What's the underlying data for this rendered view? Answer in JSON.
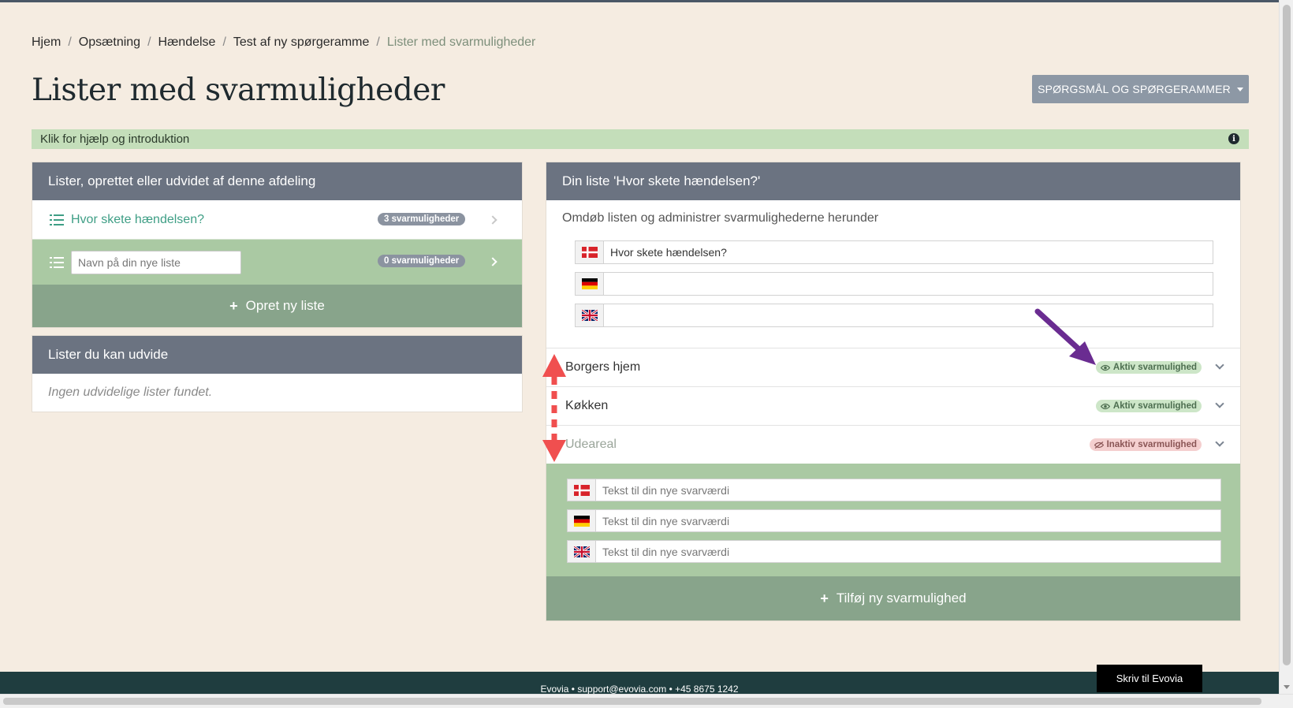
{
  "breadcrumb": {
    "items": [
      "Hjem",
      "Opsætning",
      "Hændelse",
      "Test af ny spørgeramme"
    ],
    "active": "Lister med svarmuligheder",
    "separator": "/"
  },
  "page": {
    "title": "Lister med svarmuligheder",
    "dropdown_label": "SPØRGSMÅL OG SPØRGERAMMER"
  },
  "help": {
    "text": "Klik for hjælp og introduktion",
    "icon": "info-icon"
  },
  "lists_panel": {
    "header": "Lister, oprettet eller udvidet af denne afdeling",
    "items": [
      {
        "label": "Hvor skete hændelsen?",
        "badge": "3 svarmuligheder"
      }
    ],
    "new_list": {
      "placeholder": "Navn på din nye liste",
      "badge": "0 svarmuligheder"
    },
    "create_label": "Opret ny liste"
  },
  "extend_panel": {
    "header": "Lister du kan udvide",
    "empty_text": "Ingen udvidelige lister fundet."
  },
  "detail_panel": {
    "header": "Din liste 'Hvor skete hændelsen?'",
    "subtitle": "Omdøb listen og administrer svarmulighederne herunder",
    "name_inputs": [
      {
        "flag": "dk-flag",
        "value": "Hvor skete hændelsen?"
      },
      {
        "flag": "de-flag",
        "value": ""
      },
      {
        "flag": "gb-flag",
        "value": ""
      }
    ],
    "options": [
      {
        "label": "Borgers hjem",
        "status": "Aktiv svarmulighed",
        "state": "active"
      },
      {
        "label": "Køkken",
        "status": "Aktiv svarmulighed",
        "state": "active"
      },
      {
        "label": "Udeareal",
        "status": "Inaktiv svarmulighed",
        "state": "inactive"
      }
    ],
    "new_value_inputs": [
      {
        "flag": "dk-flag",
        "placeholder": "Tekst til din nye svarværdi"
      },
      {
        "flag": "de-flag",
        "placeholder": "Tekst til din nye svarværdi"
      },
      {
        "flag": "gb-flag",
        "placeholder": "Tekst til din nye svarværdi"
      }
    ],
    "add_label": "Tilføj ny svarmulighed"
  },
  "footer": {
    "text": "Evovia • support@evovia.com • +45 8675 1242"
  },
  "chat": {
    "label": "Skriv til Evovia"
  },
  "colors": {
    "background": "#f5ece1",
    "panel_header": "#6b7381",
    "green_light": "#aac9a3",
    "green_dark": "#88a48b",
    "link": "#3e9e85",
    "annotation_purple": "#6a2c91",
    "annotation_red": "#f04f4f"
  }
}
